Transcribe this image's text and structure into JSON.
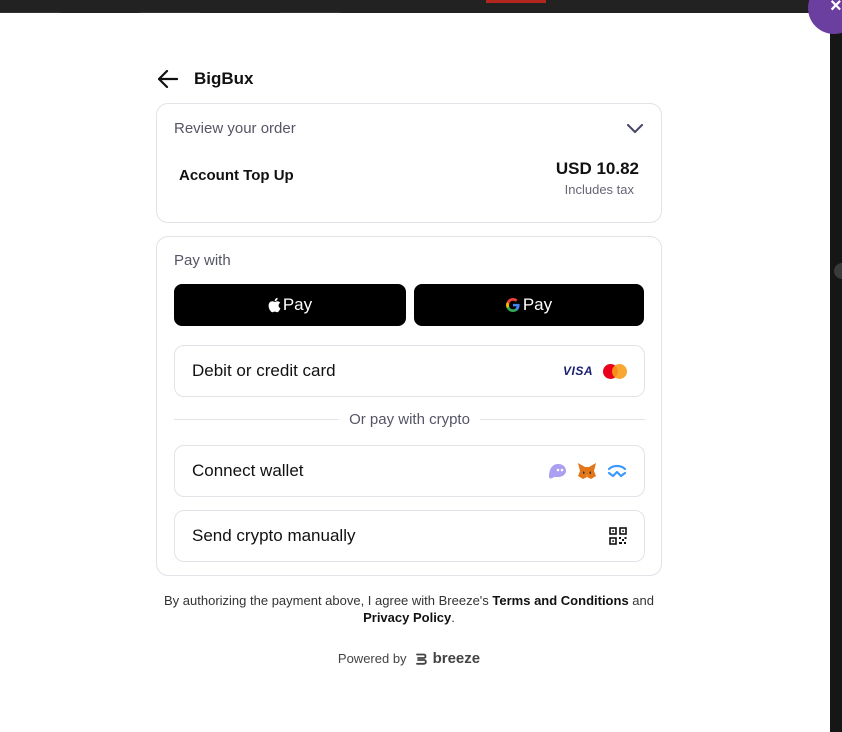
{
  "dialog": {
    "close_label": "×",
    "merchant": "BigBux"
  },
  "order": {
    "review_label": "Review your order",
    "item_name": "Account Top Up",
    "price": "USD 10.82",
    "tax_note": "Includes tax"
  },
  "pay": {
    "label": "Pay with",
    "apple_pay_label": "Pay",
    "google_pay_label": "Pay",
    "card_option": "Debit or credit card",
    "card_brands": [
      "VISA"
    ],
    "divider": "Or pay with crypto",
    "connect_wallet": "Connect wallet",
    "send_manually": "Send crypto manually"
  },
  "legal": {
    "prefix": "By authorizing the payment above, I agree with Breeze's ",
    "terms": "Terms and Conditions",
    "middle": " and",
    "privacy": "Privacy Policy",
    "suffix": "."
  },
  "footer": {
    "powered_by": "Powered by",
    "brand": "breeze"
  },
  "colors": {
    "accent": "#6b3fa0",
    "wallet_buttons": "#000000",
    "border": "#e2e2e8"
  }
}
